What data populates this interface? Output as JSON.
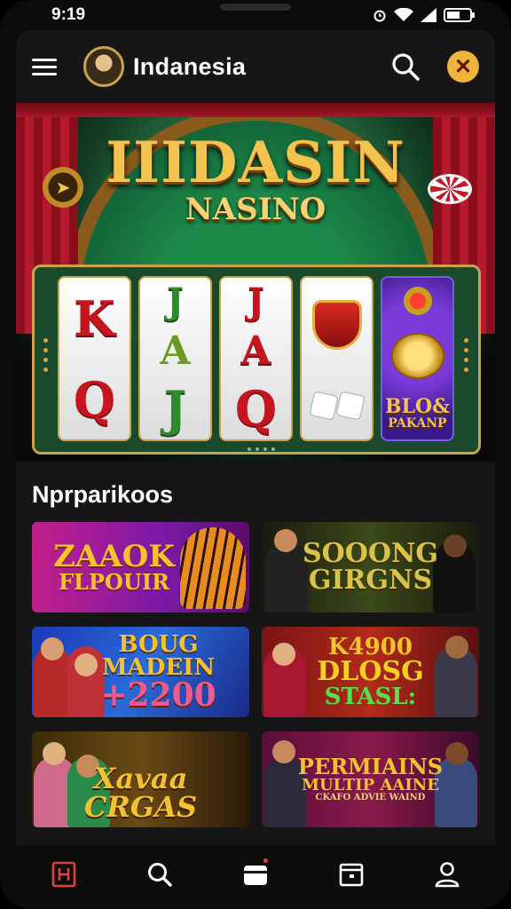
{
  "status": {
    "time": "9:19"
  },
  "appbar": {
    "title": "Indanesia"
  },
  "hero": {
    "title": "IIIDASIN",
    "subtitle": "NASINO",
    "reels": [
      {
        "top": "K",
        "bottom": "Q",
        "color": "red"
      },
      {
        "top": "J",
        "middle": "A",
        "bottom": "J",
        "color": "green"
      },
      {
        "top": "J",
        "middle": "A",
        "bottom": "Q",
        "color": "red"
      }
    ],
    "bonus_label_1": "BLO&",
    "bonus_label_2": "PAKANP"
  },
  "section": {
    "title": "Nprparikoos"
  },
  "cards": [
    {
      "line1": "ZAAOK",
      "line2": "FLPOUIR"
    },
    {
      "line1": "SOOONG",
      "line2": "GIRGNS"
    },
    {
      "line1": "BOUG",
      "line2": "MADEIN",
      "line3": "+2200"
    },
    {
      "line1": "K4900",
      "line2": "DLOSG",
      "line3": "STASL:"
    },
    {
      "line1": "Xavaa",
      "line2": "CRGAS"
    },
    {
      "line1": "PERMIAINS",
      "line2": "MULTIP AAINE",
      "line3": "CKAFO ADVIE WAIND"
    }
  ],
  "nav": [
    "home-icon",
    "search-icon",
    "wallet-icon",
    "calendar-icon",
    "profile-icon"
  ],
  "colors": {
    "accent": "#f0b33c",
    "gold": "#f3c34f",
    "background": "#161616"
  }
}
